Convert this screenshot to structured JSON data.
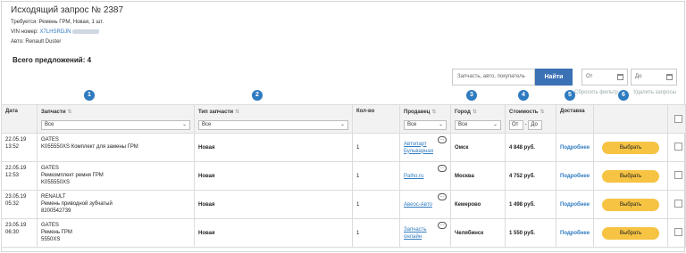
{
  "header": {
    "title": "Исходящий запрос № 2387",
    "required": "Требуется: Ремень ГРМ, Новая, 1 шт.",
    "vin_label": "VIN номер:",
    "vin_value": "X7LHSRDJN",
    "auto": "Авто: Renault Duster",
    "total": "Всего предложений: 4"
  },
  "toolbar": {
    "search_placeholder": "Запчасть, авто, покупатель",
    "find_label": "Найти",
    "date_from": "От",
    "date_to": "До",
    "reset_filter": "Сбросить фильтр",
    "delete_requests": "Удалить запросы"
  },
  "markers": [
    "1",
    "2",
    "3",
    "4",
    "5",
    "6"
  ],
  "table": {
    "columns": {
      "date": "Дата",
      "parts": "Запчасти",
      "type": "Тип запчасти",
      "qty": "Кол-во",
      "seller": "Продавец",
      "city": "Город",
      "cost": "Стоимость",
      "delivery": "Доставка"
    },
    "filters": {
      "parts": "Все",
      "type": "Все",
      "seller": "Все",
      "city": "Все",
      "cost_from": "От",
      "cost_dash": "-",
      "cost_to": "До"
    },
    "rows": [
      {
        "date": "22.05.19",
        "time": "13:52",
        "brand": "GATES",
        "part": "K055550XS Комплект для замены ГРМ",
        "part2": "",
        "type": "Новая",
        "qty": "1",
        "seller": "Автопарт",
        "seller2": "Бульварная",
        "city": "Омск",
        "cost": "4 848 руб.",
        "delivery": "Подробнее",
        "action": "Выбрать"
      },
      {
        "date": "22.05.19",
        "time": "12:53",
        "brand": "GATES",
        "part": "Ремкомплект ремня ГРМ",
        "part2": "K055550XS",
        "type": "Новая",
        "qty": "1",
        "seller": "Palho.ru",
        "seller2": "",
        "city": "Москва",
        "cost": "4 752 руб.",
        "delivery": "Подробнее",
        "action": "Выбрать"
      },
      {
        "date": "23.05.19",
        "time": "05:32",
        "brand": "RENAULT",
        "part": "Ремень приводной зубчатый",
        "part2": "8200542739",
        "type": "Новая",
        "qty": "1",
        "seller": "Авеос-Авто",
        "seller2": "",
        "city": "Кемерово",
        "cost": "1 498 руб.",
        "delivery": "Подробнее",
        "action": "Выбрать"
      },
      {
        "date": "23.05.19",
        "time": "06:30",
        "brand": "GATES",
        "part": "Ремень ГРМ",
        "part2": "5550XS",
        "type": "Новая",
        "qty": "1",
        "seller": "Запчасть",
        "seller2": "онлайн",
        "city": "Челябинск",
        "cost": "1 550 руб.",
        "delivery": "Подробнее",
        "action": "Выбрать"
      }
    ]
  },
  "colors": {
    "accent": "#3b71b5",
    "marker": "#2f7bc0",
    "choose_button": "#f6c343"
  }
}
